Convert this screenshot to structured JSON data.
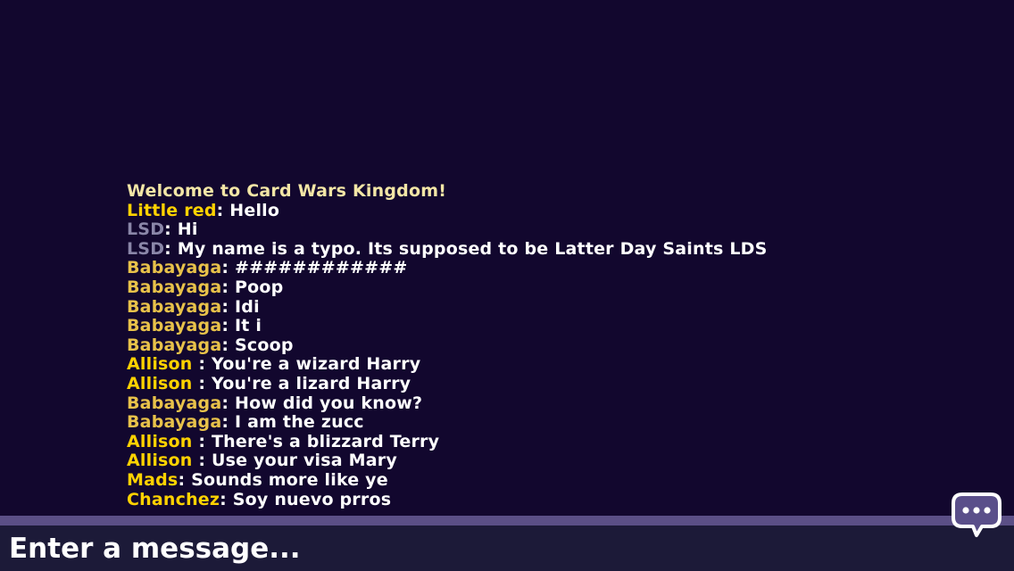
{
  "chat": {
    "welcome": "Welcome to Card Wars Kingdom!",
    "messages": [
      {
        "sender": "Little red",
        "sep": ": ",
        "text": "Hello",
        "color": "#ffd200"
      },
      {
        "sender": "LSD",
        "sep": ": ",
        "text": "Hi",
        "color": "#8a86a8"
      },
      {
        "sender": "LSD",
        "sep": ": ",
        "text": "My name is a typo. Its supposed to be Latter Day Saints LDS",
        "color": "#8a86a8"
      },
      {
        "sender": "Babayaga",
        "sep": ": ",
        "text": "############",
        "color": "#e8c24a"
      },
      {
        "sender": "Babayaga",
        "sep": ": ",
        "text": "Poop",
        "color": "#e8c24a"
      },
      {
        "sender": "Babayaga",
        "sep": ": ",
        "text": "Idi",
        "color": "#e8c24a"
      },
      {
        "sender": "Babayaga",
        "sep": ": ",
        "text": "It i",
        "color": "#e8c24a"
      },
      {
        "sender": "Babayaga",
        "sep": ": ",
        "text": "Scoop",
        "color": "#e8c24a"
      },
      {
        "sender": "Allison ",
        "sep": ": ",
        "text": "You're a wizard Harry",
        "color": "#ffd200"
      },
      {
        "sender": "Allison ",
        "sep": ": ",
        "text": "You're a lizard Harry",
        "color": "#ffd200"
      },
      {
        "sender": "Babayaga",
        "sep": ": ",
        "text": "How did you know?",
        "color": "#e8c24a"
      },
      {
        "sender": "Babayaga",
        "sep": ": ",
        "text": "I am the zucc",
        "color": "#e8c24a"
      },
      {
        "sender": "Allison ",
        "sep": ": ",
        "text": "There's a blizzard Terry",
        "color": "#ffd200"
      },
      {
        "sender": "Allison ",
        "sep": ": ",
        "text": "Use your visa Mary",
        "color": "#ffd200"
      },
      {
        "sender": "Mads",
        "sep": ": ",
        "text": "Sounds more like ye",
        "color": "#ffd200"
      },
      {
        "sender": "Chanchez",
        "sep": ": ",
        "text": "Soy nuevo prros",
        "color": "#ffd200"
      }
    ]
  },
  "input": {
    "placeholder": "Enter a message..."
  },
  "icons": {
    "chat_toggle": "speech-bubble-icon"
  },
  "colors": {
    "background": "#12072e",
    "divider": "#5b4f86",
    "input_bar": "#1c1a38",
    "welcome": "#f3e6a6",
    "message_text": "#ffffff",
    "bubble_fill": "#5a4f8a",
    "bubble_outline": "#ffffff"
  }
}
